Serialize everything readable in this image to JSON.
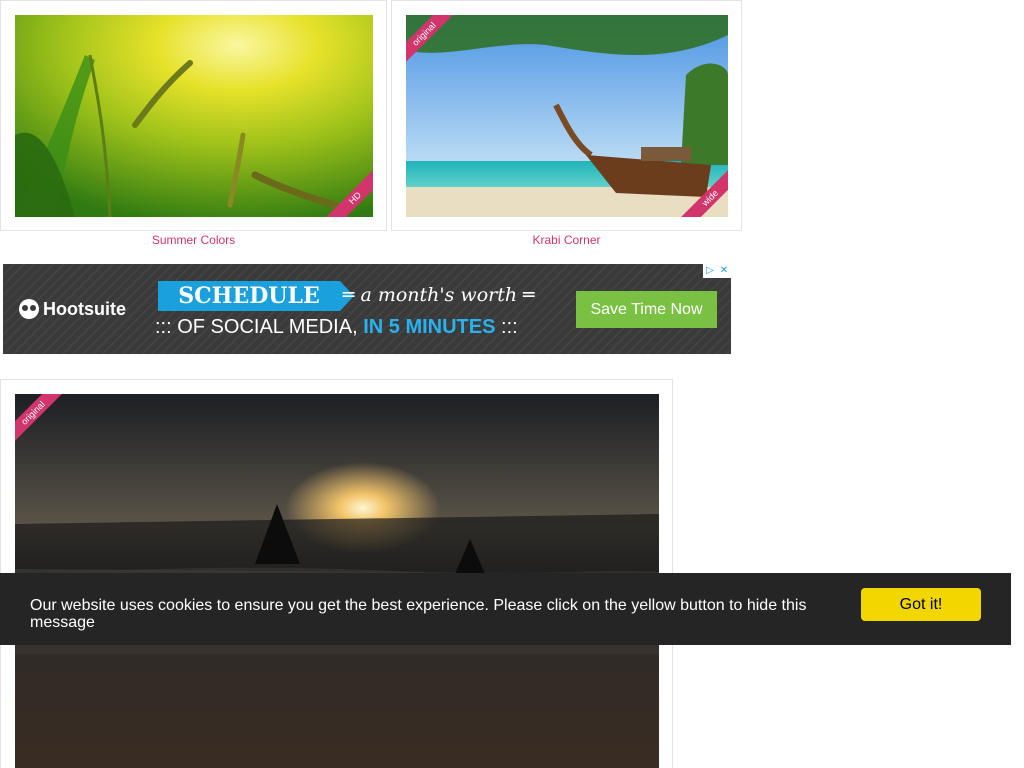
{
  "gallery": {
    "items": [
      {
        "title": "Summer Colors",
        "badge": "HD"
      },
      {
        "title": "Krabi Corner",
        "badge_top": "original",
        "badge_bottom": "wide"
      },
      {
        "badge_top": "original"
      }
    ]
  },
  "ad": {
    "brand": "Hootsuite",
    "headline": "SCHEDULE",
    "tagline": "a month's worth",
    "line2_prefix": "::: OF SOCIAL MEDIA,",
    "line2_highlight": "IN 5 MINUTES",
    "line2_suffix": ":::",
    "cta": "Save Time Now",
    "adchoices_icon": "adchoices-icon",
    "close_icon": "close-icon",
    "colors": {
      "background": "#3a3a3a",
      "accent": "#1aa0dc",
      "cta": "#7ac143"
    }
  },
  "cookie_bar": {
    "message": "Our website uses cookies to ensure you get the best experience. Please click on the yellow button to hide this message",
    "button": "Got it!",
    "colors": {
      "background": "#252525",
      "button": "#f1d600"
    }
  },
  "colors": {
    "caption": "#d1356b",
    "ribbon": "#d1356b"
  }
}
